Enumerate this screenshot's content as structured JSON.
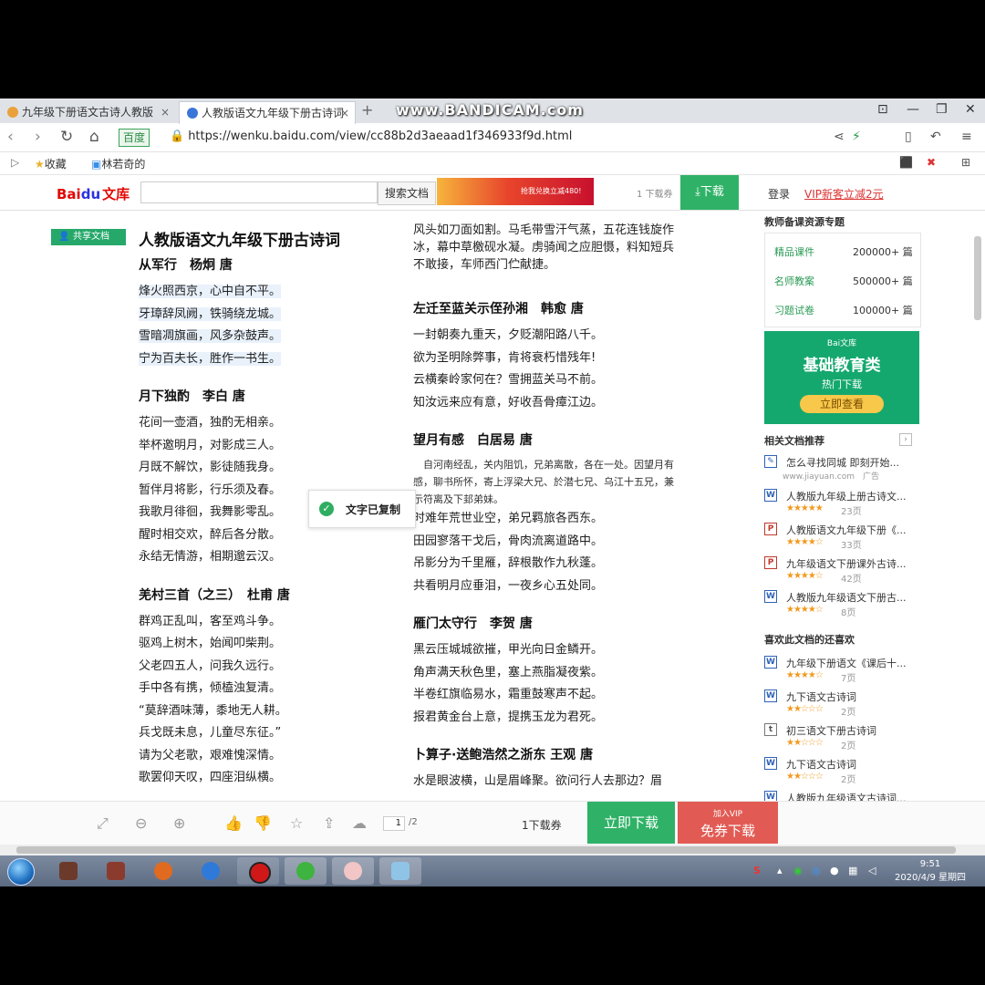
{
  "browser": {
    "tabs": [
      {
        "label": "九年级下册语文古诗人教版",
        "close": "×"
      },
      {
        "label": "人教版语文九年级下册古诗词",
        "close": "×"
      }
    ],
    "new_tab": "+",
    "watermark": "www.BANDICAM.com",
    "address": {
      "engine": "百度",
      "url": "https://wenku.baidu.com/view/cc88b2d3aeaad1f346933f9d.html"
    },
    "bookmarks": {
      "favorites": "收藏",
      "item1": "林若奇的"
    }
  },
  "wenku": {
    "logo": {
      "p1": "Bai",
      "p2": "du",
      "p3": "文库"
    },
    "search_btn": "搜索文档",
    "ad_text": "抢我兑换立减480!",
    "download_count": "1 下载券",
    "download_btn": "下载",
    "login": "登录",
    "vip_promo": "VIP新客立减2元"
  },
  "document": {
    "share_tag": "共享文档",
    "title": "人教版语文九年级下册古诗词",
    "left_col": [
      {
        "type": "h",
        "text": "从军行　杨炯 唐"
      },
      {
        "type": "l",
        "text": "烽火照西京，心中自不平。",
        "sel": true
      },
      {
        "type": "l",
        "text": "牙璋辞凤阙，铁骑绕龙城。",
        "sel": true
      },
      {
        "type": "l",
        "text": "雪暗凋旗画，风多杂鼓声。",
        "sel": true
      },
      {
        "type": "l",
        "text": "宁为百夫长，胜作一书生。",
        "sel": true
      },
      {
        "type": "h",
        "text": "月下独酌　李白 唐"
      },
      {
        "type": "l",
        "text": "花间一壶酒，独酌无相亲。"
      },
      {
        "type": "l",
        "text": "举杯邀明月，对影成三人。"
      },
      {
        "type": "l",
        "text": "月既不解饮，影徒随我身。"
      },
      {
        "type": "l",
        "text": "暂伴月将影，行乐须及春。"
      },
      {
        "type": "l",
        "text": "我歌月徘徊，我舞影零乱。"
      },
      {
        "type": "l",
        "text": "醒时相交欢，醉后各分散。"
      },
      {
        "type": "l",
        "text": "永结无情游，相期邈云汉。"
      },
      {
        "type": "h",
        "text": "羌村三首（之三）　杜甫 唐"
      },
      {
        "type": "l",
        "text": "群鸡正乱叫，客至鸡斗争。"
      },
      {
        "type": "l",
        "text": "驱鸡上树木，始闻叩柴荆。"
      },
      {
        "type": "l",
        "text": "父老四五人，问我久远行。"
      },
      {
        "type": "l",
        "text": "手中各有携，倾榼浊复清。"
      },
      {
        "type": "l",
        "text": "“莫辞酒味薄，黍地无人耕。"
      },
      {
        "type": "l",
        "text": "兵戈既未息，儿童尽东征。”"
      },
      {
        "type": "l",
        "text": "请为父老歌，艰难愧深情。"
      },
      {
        "type": "l",
        "text": "歌罢仰天叹，四座泪纵横。"
      }
    ],
    "right_col": [
      {
        "type": "p",
        "text": "风头如刀面如割。马毛带雪汗气蒸，五花连钱旋作冰，幕中草檄砚水凝。虏骑闻之应胆慑，料知短兵不敢接，车师西门伫献捷。"
      },
      {
        "type": "h",
        "text": "左迁至蓝关示侄孙湘　韩愈 唐"
      },
      {
        "type": "l",
        "text": "一封朝奏九重天，夕贬潮阳路八千。"
      },
      {
        "type": "l",
        "text": "欲为圣明除弊事，肯将衰朽惜残年!"
      },
      {
        "type": "l",
        "text": "云横秦岭家何在？雪拥蓝关马不前。"
      },
      {
        "type": "l",
        "text": "知汝远来应有意，好收吾骨瘴江边。"
      },
      {
        "type": "h",
        "text": "望月有感　白居易 唐"
      },
      {
        "type": "s",
        "text": "自河南经乱，关内阻饥，兄弟离散，各在一处。因望月有感，聊书所怀，寄上浮梁大兄、於潜七兄、乌江十五兄，兼示符离及下邽弟妹。"
      },
      {
        "type": "l",
        "text": "时难年荒世业空，弟兄羁旅各西东。"
      },
      {
        "type": "l",
        "text": "田园寥落干戈后，骨肉流离道路中。"
      },
      {
        "type": "l",
        "text": "吊影分为千里雁，辞根散作九秋蓬。"
      },
      {
        "type": "l",
        "text": "共看明月应垂泪，一夜乡心五处同。"
      },
      {
        "type": "h",
        "text": "雁门太守行　李贺 唐"
      },
      {
        "type": "l",
        "text": "黑云压城城欲摧，甲光向日金鳞开。"
      },
      {
        "type": "l",
        "text": "角声满天秋色里，塞上燕脂凝夜紫。"
      },
      {
        "type": "l",
        "text": "半卷红旗临易水，霜重鼓寒声不起。"
      },
      {
        "type": "l",
        "text": "报君黄金台上意，提携玉龙为君死。"
      },
      {
        "type": "h",
        "text": "卜算子·送鲍浩然之浙东 王观 唐"
      },
      {
        "type": "l",
        "text": "水是眼波横，山是眉峰聚。欲问行人去那边？眉"
      }
    ],
    "toast": "文字已复制"
  },
  "sidebar": {
    "resource_title": "教师备课资源专题",
    "resources": [
      {
        "name": "精品课件",
        "count": "200000+ 篇"
      },
      {
        "name": "名师教案",
        "count": "500000+ 篇"
      },
      {
        "name": "习题试卷",
        "count": "100000+ 篇"
      }
    ],
    "banner": {
      "logo": "Bai文库",
      "title": "基础教育类",
      "sub": "热门下载",
      "btn": "立即查看"
    },
    "related_title": "相关文档推荐",
    "related": [
      {
        "icon": "link",
        "title": "怎么寻找同城 即刻开始...",
        "meta": "www.jiayuan.com　广告"
      },
      {
        "icon": "W",
        "title": "人教版九年级上册古诗文...",
        "stars": "★★★★★",
        "pages": "23页"
      },
      {
        "icon": "P",
        "title": "人教版语文九年级下册《...",
        "stars": "★★★★☆",
        "pages": "33页"
      },
      {
        "icon": "P",
        "title": "九年级语文下册课外古诗...",
        "stars": "★★★★☆",
        "pages": "42页"
      },
      {
        "icon": "W",
        "title": "人教版九年级语文下册古...",
        "stars": "★★★★☆",
        "pages": "8页"
      }
    ],
    "also_title": "喜欢此文档的还喜欢",
    "also": [
      {
        "icon": "W",
        "title": "九年级下册语文《课后十...",
        "stars": "★★★★☆",
        "pages": "7页"
      },
      {
        "icon": "W",
        "title": "九下语文古诗词",
        "stars": "★★☆☆☆",
        "pages": "2页"
      },
      {
        "icon": "t",
        "title": "初三语文下册古诗词",
        "stars": "★★☆☆☆",
        "pages": "2页"
      },
      {
        "icon": "W",
        "title": "九下语文古诗词",
        "stars": "★★☆☆☆",
        "pages": "2页"
      },
      {
        "icon": "W",
        "title": "人教版九年级语文古诗词..."
      }
    ]
  },
  "bottom": {
    "page_current": "1",
    "page_total": "/2",
    "download_count": "1下载券",
    "download_btn": "立即下载",
    "vip_top": "加入VIP",
    "vip_btn": "免券下载"
  },
  "taskbar": {
    "time": "9:51",
    "date": "2020/4/9 星期四"
  }
}
